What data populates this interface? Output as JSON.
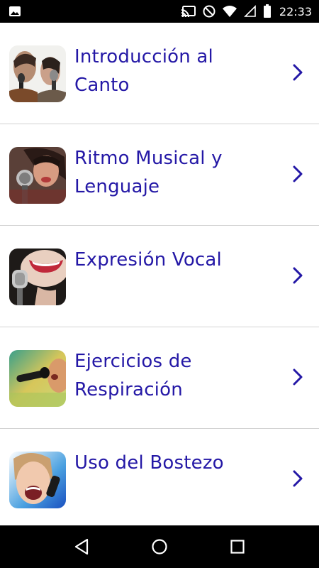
{
  "status_bar": {
    "time": "22:33",
    "icons": [
      "image-icon",
      "cast-icon",
      "do-not-disturb-icon",
      "wifi-icon",
      "no-signal-icon",
      "battery-icon"
    ]
  },
  "lessons": [
    {
      "title": "Introducción al Canto",
      "thumbnail": "singers-microphone-image"
    },
    {
      "title": "Ritmo Musical y Lenguaje",
      "thumbnail": "woman-singer-image"
    },
    {
      "title": "Expresión Vocal",
      "thumbnail": "smiling-singer-microphone-image"
    },
    {
      "title": "Ejercicios de Respiración",
      "thumbnail": "microphone-breathing-image"
    },
    {
      "title": "Uso del Bostezo",
      "thumbnail": "girl-singing-image"
    }
  ],
  "navigation": {
    "icons": [
      "back-icon",
      "home-icon",
      "recents-icon"
    ]
  },
  "colors": {
    "title": "#2418a6",
    "chevron": "#2418a6",
    "divider": "#d2d2d2",
    "bars": "#000000"
  }
}
